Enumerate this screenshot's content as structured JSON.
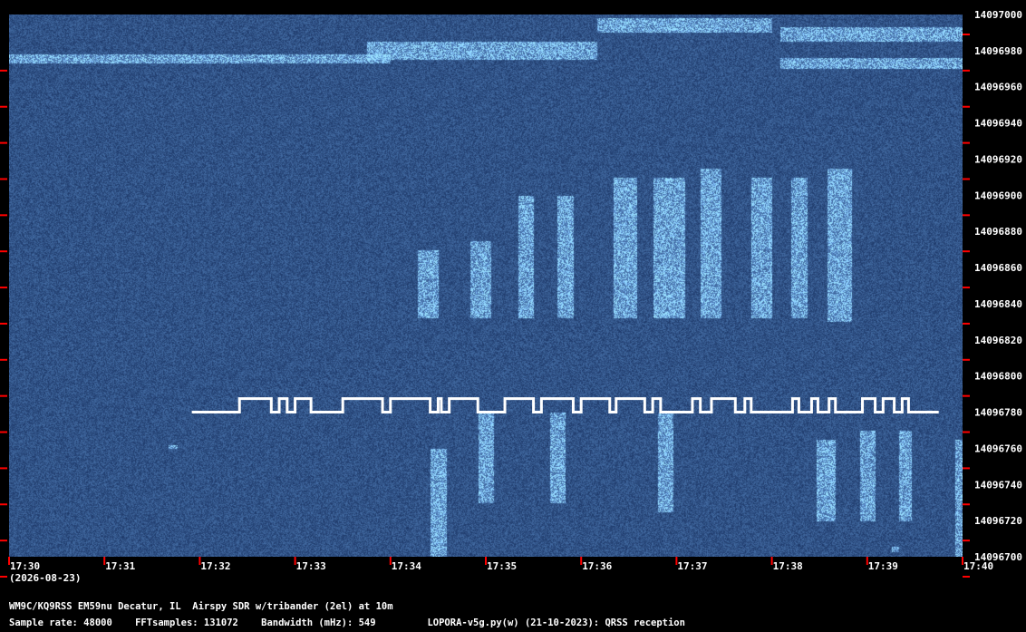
{
  "chart_data": {
    "type": "heatmap",
    "description_type": "waterfall spectrogram",
    "y_axis": {
      "ticks": [
        14097000,
        14096980,
        14096960,
        14096940,
        14096920,
        14096900,
        14096880,
        14096860,
        14096840,
        14096820,
        14096800,
        14096780,
        14096760,
        14096740,
        14096720,
        14096700
      ],
      "ylim": [
        14096700,
        14097000
      ]
    },
    "x_axis": {
      "ticks": [
        "17:30",
        "17:31",
        "17:32",
        "17:33",
        "17:34",
        "17:35",
        "17:36",
        "17:37",
        "17:38",
        "17:39",
        "17:40"
      ],
      "date_label": "(2026-08-23)"
    },
    "colors": {
      "background": "#0a1f4a",
      "signal": "#bfe0ff",
      "tick_marker": "#ff0000"
    },
    "overlay_trace": {
      "color": "#ffffff",
      "levels_hz": [
        14096780,
        14096785
      ],
      "steps": [
        {
          "t": "17:31:55",
          "level": 0
        },
        {
          "t": "17:32:25",
          "level": 1
        },
        {
          "t": "17:32:45",
          "level": 0
        },
        {
          "t": "17:32:50",
          "level": 1
        },
        {
          "t": "17:32:55",
          "level": 0
        },
        {
          "t": "17:33:00",
          "level": 1
        },
        {
          "t": "17:33:10",
          "level": 0
        },
        {
          "t": "17:33:30",
          "level": 1
        },
        {
          "t": "17:33:55",
          "level": 0
        },
        {
          "t": "17:34:00",
          "level": 1
        },
        {
          "t": "17:34:25",
          "level": 0
        },
        {
          "t": "17:34:30",
          "level": 1
        },
        {
          "t": "17:34:32",
          "level": 0
        },
        {
          "t": "17:34:37",
          "level": 1
        },
        {
          "t": "17:34:55",
          "level": 0
        },
        {
          "t": "17:35:12",
          "level": 1
        },
        {
          "t": "17:35:30",
          "level": 0
        },
        {
          "t": "17:35:35",
          "level": 1
        },
        {
          "t": "17:35:55",
          "level": 0
        },
        {
          "t": "17:36:00",
          "level": 1
        },
        {
          "t": "17:36:18",
          "level": 0
        },
        {
          "t": "17:36:22",
          "level": 1
        },
        {
          "t": "17:36:40",
          "level": 0
        },
        {
          "t": "17:36:45",
          "level": 1
        },
        {
          "t": "17:36:50",
          "level": 0
        },
        {
          "t": "17:37:10",
          "level": 1
        },
        {
          "t": "17:37:15",
          "level": 0
        },
        {
          "t": "17:37:22",
          "level": 1
        },
        {
          "t": "17:37:37",
          "level": 0
        },
        {
          "t": "17:37:43",
          "level": 1
        },
        {
          "t": "17:37:47",
          "level": 0
        },
        {
          "t": "17:38:13",
          "level": 1
        },
        {
          "t": "17:38:17",
          "level": 0
        },
        {
          "t": "17:38:25",
          "level": 1
        },
        {
          "t": "17:38:29",
          "level": 0
        },
        {
          "t": "17:38:36",
          "level": 1
        },
        {
          "t": "17:38:40",
          "level": 0
        },
        {
          "t": "17:38:57",
          "level": 1
        },
        {
          "t": "17:39:05",
          "level": 0
        },
        {
          "t": "17:39:10",
          "level": 1
        },
        {
          "t": "17:39:17",
          "level": 0
        },
        {
          "t": "17:39:22",
          "level": 1
        },
        {
          "t": "17:39:26",
          "level": 0
        },
        {
          "t": "17:39:45",
          "level": 0
        }
      ]
    },
    "signal_bursts": [
      {
        "t0": "17:34:17",
        "t1": "17:34:30",
        "f0": 14096832,
        "f1": 14096870
      },
      {
        "t0": "17:34:50",
        "t1": "17:35:03",
        "f0": 14096832,
        "f1": 14096875
      },
      {
        "t0": "17:35:20",
        "t1": "17:35:30",
        "f0": 14096832,
        "f1": 14096900
      },
      {
        "t0": "17:35:45",
        "t1": "17:35:55",
        "f0": 14096832,
        "f1": 14096900
      },
      {
        "t0": "17:36:20",
        "t1": "17:36:35",
        "f0": 14096832,
        "f1": 14096910
      },
      {
        "t0": "17:36:45",
        "t1": "17:37:05",
        "f0": 14096832,
        "f1": 14096910
      },
      {
        "t0": "17:37:15",
        "t1": "17:37:28",
        "f0": 14096832,
        "f1": 14096915
      },
      {
        "t0": "17:37:47",
        "t1": "17:38:00",
        "f0": 14096832,
        "f1": 14096910
      },
      {
        "t0": "17:38:12",
        "t1": "17:38:22",
        "f0": 14096832,
        "f1": 14096910
      },
      {
        "t0": "17:38:35",
        "t1": "17:38:50",
        "f0": 14096830,
        "f1": 14096915
      },
      {
        "t0": "17:34:25",
        "t1": "17:34:35",
        "f0": 14096700,
        "f1": 14096760
      },
      {
        "t0": "17:34:55",
        "t1": "17:35:05",
        "f0": 14096730,
        "f1": 14096780
      },
      {
        "t0": "17:35:40",
        "t1": "17:35:50",
        "f0": 14096730,
        "f1": 14096780
      },
      {
        "t0": "17:36:48",
        "t1": "17:36:58",
        "f0": 14096725,
        "f1": 14096780
      },
      {
        "t0": "17:38:28",
        "t1": "17:38:40",
        "f0": 14096720,
        "f1": 14096765
      },
      {
        "t0": "17:38:55",
        "t1": "17:39:05",
        "f0": 14096720,
        "f1": 14096770
      },
      {
        "t0": "17:39:20",
        "t1": "17:39:28",
        "f0": 14096720,
        "f1": 14096770
      },
      {
        "t0": "17:39:55",
        "t1": "17:40:00",
        "f0": 14096700,
        "f1": 14096765
      },
      {
        "t0": "17:30:00",
        "t1": "17:34:00",
        "f0": 14096973,
        "f1": 14096978
      },
      {
        "t0": "17:33:45",
        "t1": "17:36:10",
        "f0": 14096975,
        "f1": 14096985
      },
      {
        "t0": "17:36:10",
        "t1": "17:38:00",
        "f0": 14096990,
        "f1": 14096998
      },
      {
        "t0": "17:38:05",
        "t1": "17:40:00",
        "f0": 14096985,
        "f1": 14096993
      },
      {
        "t0": "17:38:05",
        "t1": "17:40:00",
        "f0": 14096970,
        "f1": 14096976
      },
      {
        "t0": "17:31:40",
        "t1": "17:31:46",
        "f0": 14096760,
        "f1": 14096762
      },
      {
        "t0": "17:39:15",
        "t1": "17:39:20",
        "f0": 14096703,
        "f1": 14096706
      }
    ]
  },
  "footer": {
    "station": "WM9C/KQ9RSS EM59nu Decatur, IL  Airspy SDR w/tribander (2el) at 10m",
    "params": "Sample rate: 48000    FFTsamples: 131072    Bandwidth (mHz): 549         LOPORA-v5g.py(w) (21-10-2023): QRSS reception"
  }
}
